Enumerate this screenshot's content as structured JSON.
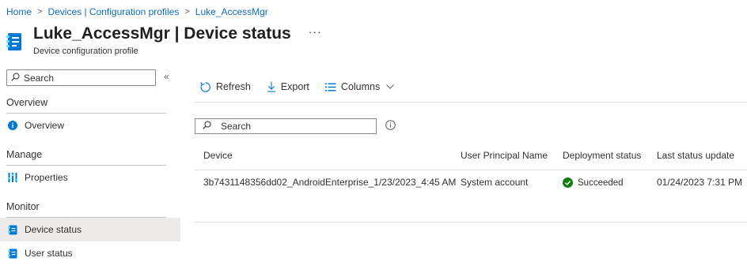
{
  "breadcrumb": {
    "items": [
      "Home",
      "Devices | Configuration profiles",
      "Luke_AccessMgr"
    ],
    "separator": ">"
  },
  "header": {
    "title_strong": "Luke_AccessMgr",
    "title_rest": " | Device status",
    "subtitle": "Device configuration profile",
    "more": "···"
  },
  "sidebar": {
    "search_placeholder": "Search",
    "collapse": "«",
    "sections": [
      {
        "title": "Overview",
        "items": [
          {
            "label": "Overview",
            "icon": "info-icon"
          }
        ]
      },
      {
        "title": "Manage",
        "items": [
          {
            "label": "Properties",
            "icon": "properties-icon"
          }
        ]
      },
      {
        "title": "Monitor",
        "items": [
          {
            "label": "Device status",
            "icon": "device-status-icon",
            "active": true
          },
          {
            "label": "User status",
            "icon": "user-status-icon"
          }
        ]
      }
    ]
  },
  "toolbar": {
    "refresh": "Refresh",
    "export": "Export",
    "columns": "Columns"
  },
  "main": {
    "search_placeholder": "Search"
  },
  "table": {
    "columns": [
      "Device",
      "User Principal Name",
      "Deployment status",
      "Last status update"
    ],
    "rows": [
      {
        "device": "3b7431148356dd02_AndroidEnterprise_1/23/2023_4:45 AM",
        "upn": "System account",
        "status": "Succeeded",
        "last_update": "01/24/2023 7:31 PM"
      }
    ]
  },
  "colors": {
    "link": "#0f6cbd",
    "accent": "#0078d4",
    "success": "#107c10",
    "active_bg": "#edebe9"
  }
}
